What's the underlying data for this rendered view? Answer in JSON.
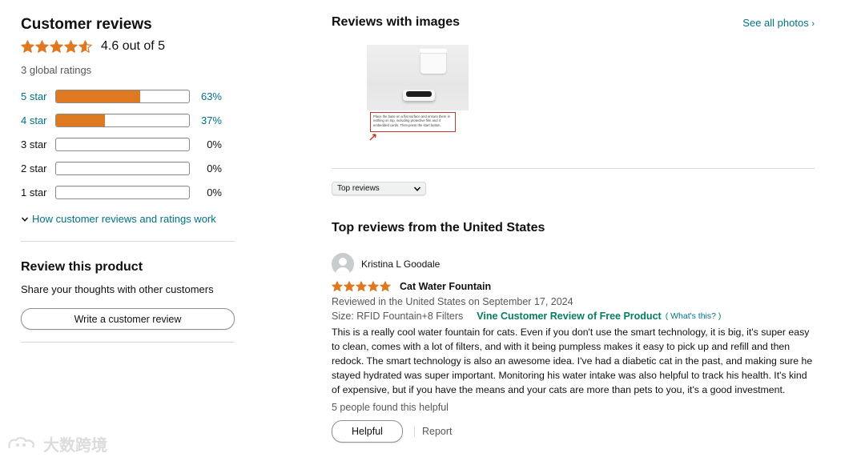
{
  "summary": {
    "title": "Customer reviews",
    "average_rating": 4.6,
    "average_text": "4.6 out of 5",
    "global_ratings": "3 global ratings",
    "histogram": [
      {
        "label": "5 star",
        "percent": 63,
        "percent_text": "63%",
        "link": true
      },
      {
        "label": "4 star",
        "percent": 37,
        "percent_text": "37%",
        "link": true
      },
      {
        "label": "3 star",
        "percent": 0,
        "percent_text": "0%",
        "link": false
      },
      {
        "label": "2 star",
        "percent": 0,
        "percent_text": "0%",
        "link": false
      },
      {
        "label": "1 star",
        "percent": 0,
        "percent_text": "0%",
        "link": false
      }
    ],
    "how_link": "How customer reviews and ratings work",
    "accent_color": "#de7921"
  },
  "review_product": {
    "title": "Review this product",
    "subtitle": "Share your thoughts with other customers",
    "button": "Write a customer review"
  },
  "images_section": {
    "title": "Reviews with images",
    "see_all": "See all photos",
    "thumb_caption": "Place the base on a flat surface and ensure there is nothing on top, including protective film and 4 embedded cards. Then press the start button."
  },
  "sort": {
    "selected": "Top reviews"
  },
  "top_reviews": {
    "title": "Top reviews from the United States",
    "reviews": [
      {
        "reviewer": "Kristina L Goodale",
        "rating": 5,
        "title": "Cat Water Fountain",
        "date": "Reviewed in the United States on September 17, 2024",
        "size": "Size: RFID Fountain+8 Filters",
        "vine": "Vine Customer Review of Free Product",
        "whats_this": "What's this?",
        "body": "This is a really cool water fountain for cats. Even if you don't use the smart technology, it is big, it's super easy to clean, comes with a lot of filters, and with it being pumpless makes it easy to pick up and refill and then redock. The smart technology is also an awesome idea. I've had a diabetic cat in the past, and making sure he stayed hydrated was super important. Monitoring his water intake was also helpful to track his health. It's kind of expensive, but if you have the means and your cats are more than pets to you, it's a good investment.",
        "helpful_count": "5 people found this helpful",
        "helpful_button": "Helpful",
        "report": "Report"
      }
    ]
  },
  "watermark": {
    "text": "大数跨境"
  }
}
